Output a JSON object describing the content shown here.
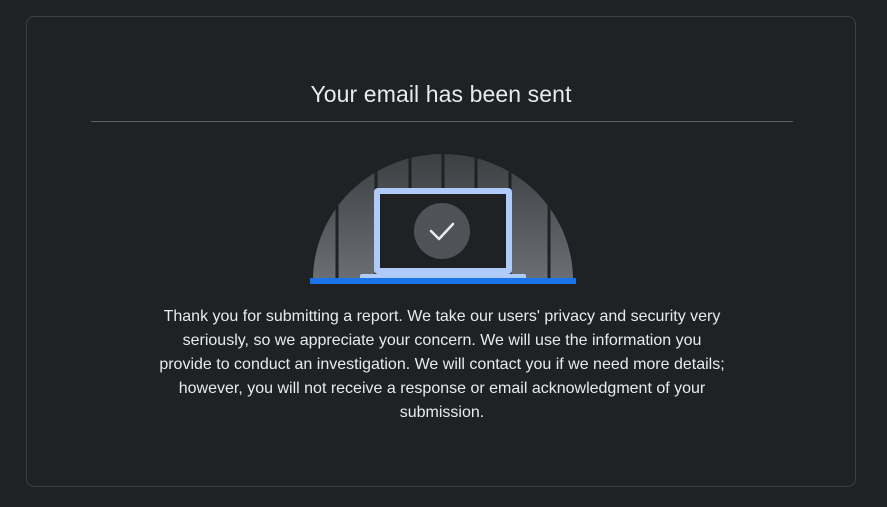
{
  "dialog": {
    "title": "Your email has been sent",
    "message": "Thank you for submitting a report. We take our users' privacy and security very seriously, so we appreciate your concern. We will use the information you provide to conduct an investigation. We will contact you if we need more details; however, you will not receive a response or email acknowledgment of your submission."
  },
  "illustration": {
    "icon": "laptop-with-checkmark",
    "colors": {
      "dome": "#3c4043",
      "dome_stripe": "#202124",
      "laptop_frame": "#aecbfa",
      "laptop_screen": "#202124",
      "check_circle": "#5f6368",
      "check_mark": "#e8eaed",
      "base_bar": "#1a73e8"
    }
  }
}
